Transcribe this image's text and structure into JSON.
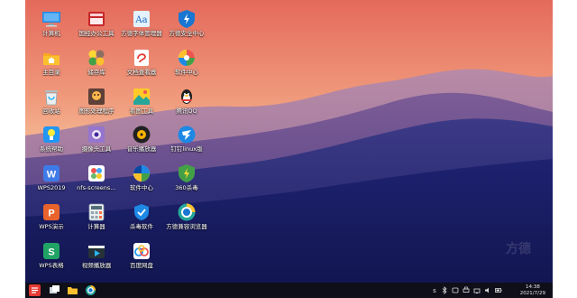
{
  "desktop": {
    "icons": [
      {
        "label": "计算机",
        "icon": "computer-icon"
      },
      {
        "label": "国经办公工具",
        "icon": "office-tools-icon"
      },
      {
        "label": "方德字体管理器",
        "icon": "font-manager-icon"
      },
      {
        "label": "方德安全中心",
        "icon": "security-center-icon"
      },
      {
        "label": "主目录",
        "icon": "home-folder-icon"
      },
      {
        "label": "储存库",
        "icon": "repository-icon"
      },
      {
        "label": "文档查看器",
        "icon": "document-viewer-icon"
      },
      {
        "label": "软件中心",
        "icon": "software-center-icon"
      },
      {
        "label": "回收站",
        "icon": "trash-icon"
      },
      {
        "label": "图形处理程序",
        "icon": "image-editor-icon"
      },
      {
        "label": "看图工具",
        "icon": "image-viewer-icon"
      },
      {
        "label": "腾讯QQ",
        "icon": "qq-icon"
      },
      {
        "label": "系统帮助",
        "icon": "help-icon"
      },
      {
        "label": "摄像头工具",
        "icon": "camera-icon"
      },
      {
        "label": "音乐播放器",
        "icon": "music-player-icon"
      },
      {
        "label": "钉钉linux版",
        "icon": "dingtalk-icon"
      },
      {
        "label": "WPS2019",
        "icon": "wps-writer-icon"
      },
      {
        "label": "nfs-screens…",
        "icon": "screenshot-icon"
      },
      {
        "label": "软件中心",
        "icon": "software-center-2-icon"
      },
      {
        "label": "360杀毒",
        "icon": "antivirus-360-icon"
      },
      {
        "label": "WPS演示",
        "icon": "wps-presentation-icon"
      },
      {
        "label": "计算器",
        "icon": "calculator-icon"
      },
      {
        "label": "杀毒软件",
        "icon": "antivirus-icon"
      },
      {
        "label": "方德兼容浏览器",
        "icon": "browser-icon"
      },
      {
        "label": "WPS表格",
        "icon": "wps-spreadsheet-icon"
      },
      {
        "label": "视频播放器",
        "icon": "video-player-icon"
      },
      {
        "label": "百度网盘",
        "icon": "baidu-netdisk-icon"
      }
    ],
    "watermark": "方德"
  },
  "taskbar": {
    "items": [
      "start-menu-icon",
      "desktop-switcher-icon",
      "file-manager-icon",
      "browser-icon"
    ],
    "tray": [
      "input-method-icon",
      "bluetooth-icon",
      "storage-icon",
      "printer-icon",
      "network-icon",
      "volume-icon",
      "battery-icon"
    ],
    "time": "14:38",
    "date": "2021/7/29"
  },
  "colors": {
    "sky_top": "#e0665a",
    "sky_bottom": "#f5c09a",
    "mountains": "#262a6e",
    "taskbar": "#0e0f19"
  }
}
